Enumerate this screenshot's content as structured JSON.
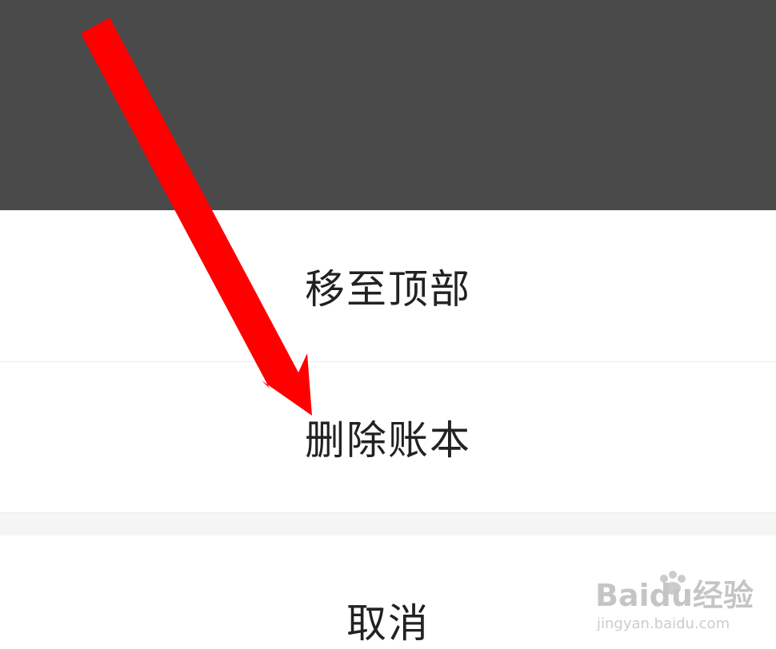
{
  "action_sheet": {
    "items": [
      {
        "label": "移至顶部"
      },
      {
        "label": "删除账本"
      }
    ],
    "cancel_label": "取消"
  },
  "watermark": {
    "brand": "Baidu经验",
    "url": "jingyan.baidu.com"
  },
  "colors": {
    "overlay": "#4a4a4a",
    "sheet": "#ffffff",
    "text": "#222222",
    "arrow": "#ff0000"
  },
  "icons": {
    "annotation": "red-arrow-icon",
    "watermark": "baidu-paw-logo"
  }
}
